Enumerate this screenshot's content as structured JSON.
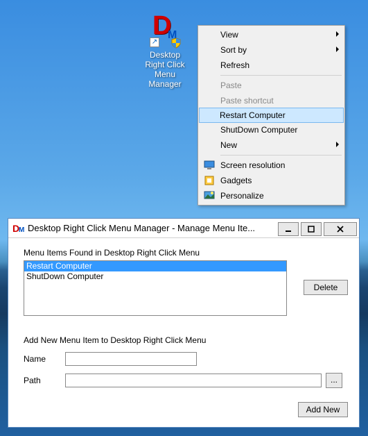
{
  "desktop_icon": {
    "label": "Desktop\nRight Click\nMenu\nManager"
  },
  "context_menu": {
    "items": [
      {
        "label": "View",
        "submenu": true
      },
      {
        "label": "Sort by",
        "submenu": true
      },
      {
        "label": "Refresh"
      },
      {
        "sep": true
      },
      {
        "label": "Paste",
        "disabled": true
      },
      {
        "label": "Paste shortcut",
        "disabled": true
      },
      {
        "label": "Restart Computer",
        "highlight": true
      },
      {
        "label": "ShutDown Computer"
      },
      {
        "label": "New",
        "submenu": true
      },
      {
        "sep": true
      },
      {
        "label": "Screen resolution",
        "icon": "monitor"
      },
      {
        "label": "Gadgets",
        "icon": "gadget"
      },
      {
        "label": "Personalize",
        "icon": "personalize"
      }
    ]
  },
  "window": {
    "title": "Desktop Right Click Menu Manager - Manage Menu Ite...",
    "section1_label": "Menu Items Found in Desktop Right Click Menu",
    "list_items": [
      {
        "text": "Restart Computer",
        "selected": true
      },
      {
        "text": "ShutDown Computer",
        "selected": false
      }
    ],
    "delete_label": "Delete",
    "section2_label": "Add New Menu Item to Desktop Right Click Menu",
    "name_label": "Name",
    "name_value": "",
    "path_label": "Path",
    "path_value": "",
    "browse_label": "...",
    "addnew_label": "Add New"
  }
}
